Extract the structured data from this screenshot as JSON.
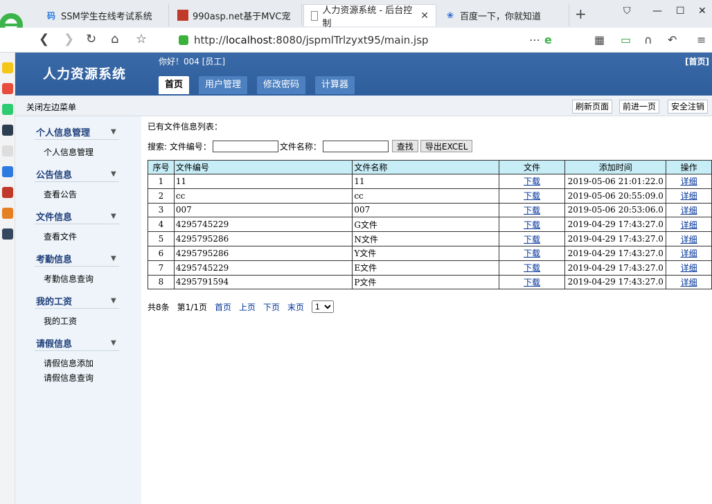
{
  "browser": {
    "tabs": [
      {
        "label": "SSM学生在线考试系统",
        "icon": "code-icon",
        "active": false
      },
      {
        "label": "990asp.net基于MVC宠",
        "icon": "red-square-icon",
        "active": false
      },
      {
        "label": "人力资源系统 - 后台控制",
        "icon": "document-icon",
        "active": true
      },
      {
        "label": "百度一下，你就知道",
        "icon": "paw-icon",
        "active": false
      }
    ],
    "address_prefix": "http://",
    "address_host": "localhost",
    "address_rest": ":8080/jspmlTrlzyxt95/main.jsp"
  },
  "header": {
    "app_title": "人力资源系统",
    "greeting": "你好！004 [员工]",
    "home_link": "[首页]"
  },
  "menu": [
    "首页",
    "用户管理",
    "修改密码",
    "计算器"
  ],
  "toolbar": {
    "close_left": "关闭左边菜单",
    "refresh": "刷新页面",
    "forward": "前进一页",
    "logout": "安全注销"
  },
  "sidebar": [
    {
      "title": "个人信息管理",
      "items": [
        "个人信息管理"
      ]
    },
    {
      "title": "公告信息",
      "items": [
        "查看公告"
      ]
    },
    {
      "title": "文件信息",
      "items": [
        "查看文件"
      ]
    },
    {
      "title": "考勤信息",
      "items": [
        "考勤信息查询"
      ]
    },
    {
      "title": "我的工资",
      "items": [
        "我的工资"
      ]
    },
    {
      "title": "请假信息",
      "items": [
        "请假信息添加",
        "请假信息查询"
      ]
    }
  ],
  "content": {
    "list_title": "已有文件信息列表：",
    "search_label": "搜索: 文件编号：",
    "name_label": "文件名称：",
    "search_button": "查找",
    "export_button": "导出EXCEL",
    "columns": [
      "序号",
      "文件编号",
      "文件名称",
      "文件",
      "添加时间",
      "操作"
    ],
    "rows": [
      {
        "idx": "1",
        "no": "11",
        "name": "11",
        "file": "下载",
        "time": "2019-05-06 21:01:22.0",
        "op": "详细"
      },
      {
        "idx": "2",
        "no": "cc",
        "name": "cc",
        "file": "下载",
        "time": "2019-05-06 20:55:09.0",
        "op": "详细"
      },
      {
        "idx": "3",
        "no": "007",
        "name": "007",
        "file": "下载",
        "time": "2019-05-06 20:53:06.0",
        "op": "详细"
      },
      {
        "idx": "4",
        "no": "4295745229",
        "name": "G文件",
        "file": "下载",
        "time": "2019-04-29 17:43:27.0",
        "op": "详细"
      },
      {
        "idx": "5",
        "no": "4295795286",
        "name": "N文件",
        "file": "下载",
        "time": "2019-04-29 17:43:27.0",
        "op": "详细"
      },
      {
        "idx": "6",
        "no": "4295795286",
        "name": "Y文件",
        "file": "下载",
        "time": "2019-04-29 17:43:27.0",
        "op": "详细"
      },
      {
        "idx": "7",
        "no": "4295745229",
        "name": "E文件",
        "file": "下载",
        "time": "2019-04-29 17:43:27.0",
        "op": "详细"
      },
      {
        "idx": "8",
        "no": "4295791594",
        "name": "P文件",
        "file": "下载",
        "time": "2019-04-29 17:43:27.0",
        "op": "详细"
      }
    ],
    "pager": {
      "total": "共8条",
      "page": "第1/1页",
      "first": "首页",
      "prev": "上页",
      "next": "下页",
      "last": "末页",
      "selected": "1"
    }
  },
  "colors": {
    "header": "#2e5d9c",
    "menu_tab": "#4d80c0",
    "table_header": "#c7edf7",
    "sidebar": "#eef4fa",
    "link": "#003399"
  }
}
